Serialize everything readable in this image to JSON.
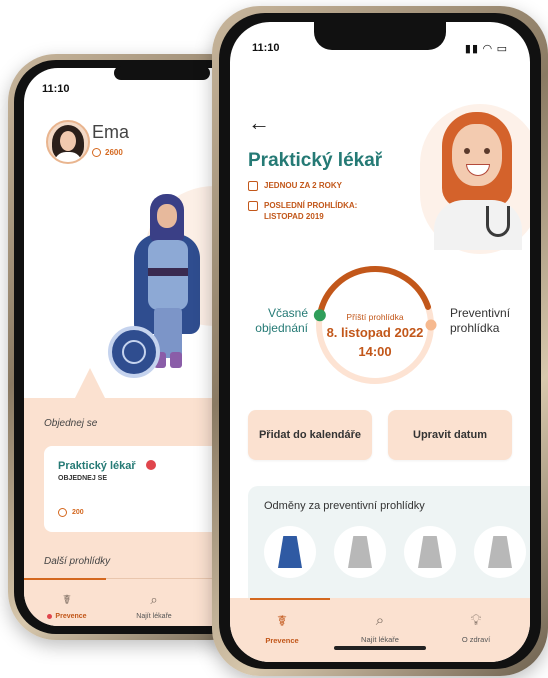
{
  "back_screen": {
    "status_time": "11:10",
    "user_name": "Ema",
    "coins": "2600",
    "section_book": "Objednej se",
    "card": {
      "title": "Praktický lékař",
      "subtitle": "OBJEDNEJ SE",
      "coins": "200"
    },
    "section_next": "Další prohlídky",
    "tabs": [
      {
        "label": "Prevence",
        "icon": "stethoscope-icon",
        "active": true
      },
      {
        "label": "Najít lékaře",
        "icon": "search-icon",
        "active": false
      }
    ]
  },
  "front_screen": {
    "status_time": "11:10",
    "status_icons": "signal wifi battery",
    "title": "Praktický lékař",
    "frequency": "JEDNOU ZA 2 ROKY",
    "last_visit_label": "POSLEDNÍ PROHLÍDKA:",
    "last_visit_date": "LISTOPAD 2019",
    "ring": {
      "left_label_1": "Včasné",
      "left_label_2": "objednání",
      "right_label_1": "Preventivní",
      "right_label_2": "prohlídka",
      "caption": "Příští prohlídka",
      "date": "8. listopad 2022",
      "time": "14:00",
      "progress": 0.42
    },
    "buttons": {
      "add_calendar": "Přidat do kalendáře",
      "edit_date": "Upravit datum"
    },
    "rewards": {
      "title": "Odměny za preventivní prohlídky",
      "items": [
        {
          "icon": "skirt-blue-icon",
          "unlocked": true
        },
        {
          "icon": "skirt-gray-icon",
          "unlocked": false
        },
        {
          "icon": "skirt-gray-icon",
          "unlocked": false
        },
        {
          "icon": "skirt-gray-icon",
          "unlocked": false
        }
      ]
    },
    "tabs": [
      {
        "label": "Prevence",
        "icon": "stethoscope-icon",
        "active": true
      },
      {
        "label": "Najít lékaře",
        "icon": "search-icon",
        "active": false
      },
      {
        "label": "O zdraví",
        "icon": "lightbulb-icon",
        "active": false
      }
    ]
  },
  "colors": {
    "accent": "#c2571a",
    "teal": "#257a75",
    "peach": "#fbe1d0",
    "alert": "#e0454c"
  }
}
